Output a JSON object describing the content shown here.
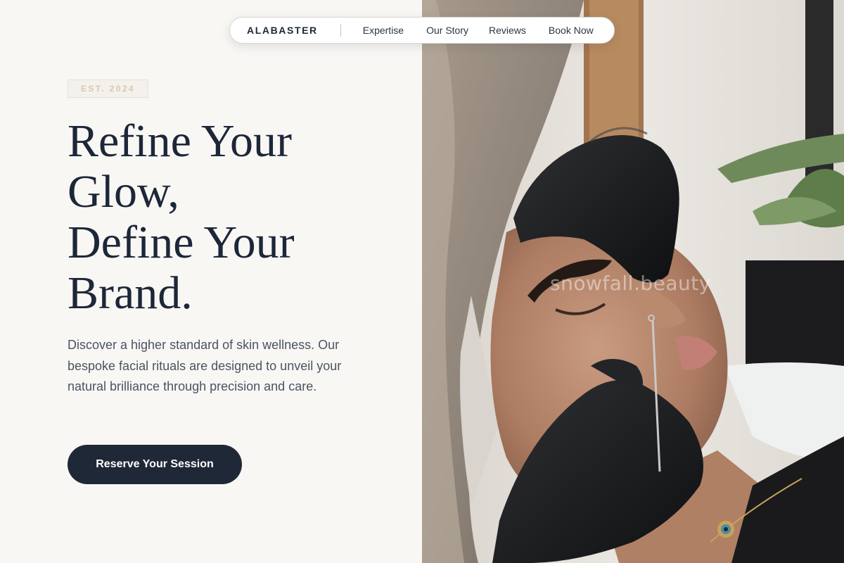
{
  "nav": {
    "brand": "ALABASTER",
    "links": [
      "Expertise",
      "Our Story",
      "Reviews",
      "Book Now"
    ]
  },
  "hero": {
    "badge": "EST. 2024",
    "headline_lines": [
      "Refine Your",
      "Glow,",
      "Define Your",
      "Brand."
    ],
    "subtitle": "Discover a higher standard of skin wellness. Our bespoke facial rituals are designed to unveil your natural brilliance through precision and care.",
    "cta_label": "Reserve Your Session"
  },
  "image": {
    "watermark": "snowfall.beauty",
    "subject": "facial-treatment-photo"
  },
  "colors": {
    "background": "#f9f7f4",
    "ink": "#1d2739",
    "accent_badge": "#d9c7b1",
    "cta_bg": "#1f2837"
  }
}
